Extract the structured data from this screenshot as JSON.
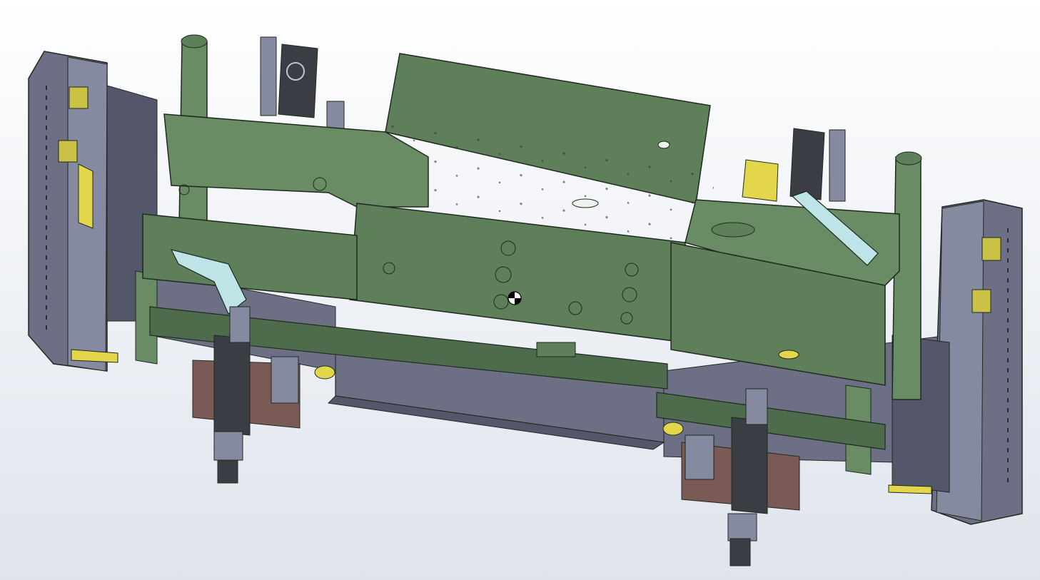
{
  "viewport": {
    "background_top": "#ffffff",
    "background_bottom": "#dfe4ec"
  },
  "model": {
    "colors": {
      "frame_green": "#5e7f5a",
      "frame_green_light": "#6a8c64",
      "frame_green_dark": "#4e6c4b",
      "edge": "#1f2a1f",
      "steel_gray": "#6d7085",
      "steel_gray_dark": "#545769",
      "steel_gray_light": "#858aa0",
      "dark_motor": "#3a3d44",
      "yellow_part": "#e3d64a",
      "cyan_arm": "#bfe4e8",
      "rust_pad": "#7a5a55"
    },
    "icons": {
      "center_of_mass": "center-of-mass-icon"
    }
  }
}
